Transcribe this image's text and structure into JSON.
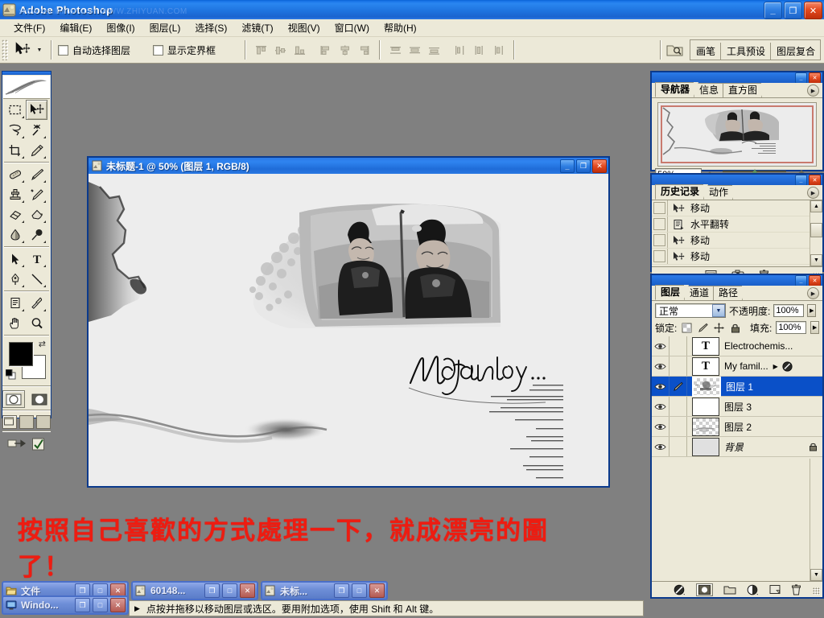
{
  "app": {
    "title": "Adobe Photoshop",
    "watermark": "www.souluntan.com  WWW.ZHIYUAN.COM",
    "icon": "photoshop-icon"
  },
  "window_buttons": {
    "minimize": "_",
    "restore": "❐",
    "close": "✕"
  },
  "menubar": {
    "items": [
      {
        "label": "文件(F)",
        "name": "menu-file"
      },
      {
        "label": "编辑(E)",
        "name": "menu-edit"
      },
      {
        "label": "图像(I)",
        "name": "menu-image"
      },
      {
        "label": "图层(L)",
        "name": "menu-layer"
      },
      {
        "label": "选择(S)",
        "name": "menu-select"
      },
      {
        "label": "滤镜(T)",
        "name": "menu-filter"
      },
      {
        "label": "视图(V)",
        "name": "menu-view"
      },
      {
        "label": "窗口(W)",
        "name": "menu-window"
      },
      {
        "label": "帮助(H)",
        "name": "menu-help"
      }
    ]
  },
  "options_bar": {
    "tool_icon": "move-tool-icon",
    "checkboxes": [
      {
        "label": "自动选择图层",
        "checked": false,
        "name": "auto-select-layer-checkbox"
      },
      {
        "label": "显示定界框",
        "checked": false,
        "name": "show-bounding-box-checkbox"
      }
    ],
    "align_group_1": [
      "align-top-edges-icon",
      "align-vertical-centers-icon",
      "align-bottom-edges-icon"
    ],
    "align_group_2": [
      "align-left-edges-icon",
      "align-horizontal-centers-icon",
      "align-right-edges-icon"
    ],
    "distribute_group_1": [
      "distribute-top-edges-icon",
      "distribute-vertical-centers-icon",
      "distribute-bottom-edges-icon"
    ],
    "distribute_group_2": [
      "distribute-left-edges-icon",
      "distribute-horizontal-centers-icon",
      "distribute-right-edges-icon"
    ],
    "file_browser_icon": "file-browser-icon",
    "palette_well": [
      {
        "label": "画笔",
        "name": "palette-well-brushes"
      },
      {
        "label": "工具预设",
        "name": "palette-well-tool-presets"
      },
      {
        "label": "图层复合",
        "name": "palette-well-layer-comps"
      }
    ]
  },
  "toolbox": {
    "tools": [
      {
        "name": "marquee-tool",
        "selected": false
      },
      {
        "name": "move-tool",
        "selected": true
      },
      {
        "name": "lasso-tool",
        "selected": false
      },
      {
        "name": "magic-wand-tool",
        "selected": false
      },
      {
        "name": "crop-tool",
        "selected": false
      },
      {
        "name": "slice-tool",
        "selected": false
      },
      {
        "name": "healing-brush-tool",
        "selected": false
      },
      {
        "name": "brush-tool",
        "selected": false
      },
      {
        "name": "clone-stamp-tool",
        "selected": false
      },
      {
        "name": "history-brush-tool",
        "selected": false
      },
      {
        "name": "eraser-tool",
        "selected": false
      },
      {
        "name": "gradient-tool",
        "selected": false
      },
      {
        "name": "blur-tool",
        "selected": false
      },
      {
        "name": "dodge-tool",
        "selected": false
      },
      {
        "name": "path-selection-tool",
        "selected": false
      },
      {
        "name": "type-tool",
        "selected": false
      },
      {
        "name": "pen-tool",
        "selected": false
      },
      {
        "name": "line-tool",
        "selected": false
      },
      {
        "name": "notes-tool",
        "selected": false
      },
      {
        "name": "eyedropper-tool",
        "selected": false
      },
      {
        "name": "hand-tool",
        "selected": false
      },
      {
        "name": "zoom-tool",
        "selected": false
      }
    ],
    "foreground_color": "#000000",
    "background_color": "#ffffff",
    "quick_mask": [
      "standard-mode",
      "quick-mask-mode"
    ],
    "screen_modes": [
      "standard-screen-mode",
      "full-screen-with-menubar",
      "full-screen-mode"
    ],
    "jump_to": [
      "jump-to-imageready-icon",
      "jump-to-edit-icon"
    ]
  },
  "document": {
    "title": "未标题-1 @ 50% (图层 1, RGB/8)",
    "icon": "document-icon",
    "zoom": "50%",
    "layer_name_in_title": "图层 1",
    "color_mode": "RGB/8",
    "script_text": "My family...",
    "buttons": {
      "minimize": "_",
      "maximize": "❐",
      "close": "✕"
    }
  },
  "annotation": {
    "text": "按照自己喜歡的方式處理一下，就成漂亮的圖了！",
    "color": "#ee1c11"
  },
  "navigator_palette": {
    "tabs": [
      {
        "label": "导航器",
        "active": true,
        "name": "tab-navigator"
      },
      {
        "label": "信息",
        "active": false,
        "name": "tab-info"
      },
      {
        "label": "直方图",
        "active": false,
        "name": "tab-histogram"
      }
    ],
    "zoom_value": "50%",
    "menu_icon": "palette-menu-icon"
  },
  "history_palette": {
    "tabs": [
      {
        "label": "历史记录",
        "active": true,
        "name": "tab-history"
      },
      {
        "label": "动作",
        "active": false,
        "name": "tab-actions"
      }
    ],
    "items": [
      {
        "label": "移动",
        "icon": "move-tool-icon"
      },
      {
        "label": "水平翻转",
        "icon": "flip-horizontal-icon"
      },
      {
        "label": "移动",
        "icon": "move-tool-icon"
      },
      {
        "label": "移动",
        "icon": "move-tool-icon"
      }
    ],
    "footer_icons": [
      "new-document-from-state-icon",
      "new-snapshot-icon",
      "delete-state-icon"
    ]
  },
  "layers_palette": {
    "tabs": [
      {
        "label": "图层",
        "active": true,
        "name": "tab-layers"
      },
      {
        "label": "通道",
        "active": false,
        "name": "tab-channels"
      },
      {
        "label": "路径",
        "active": false,
        "name": "tab-paths"
      }
    ],
    "blend_mode": "正常",
    "opacity_label": "不透明度:",
    "opacity_value": "100%",
    "lock_label": "锁定:",
    "lock_icons": [
      "lock-transparent-pixels-icon",
      "lock-image-pixels-icon",
      "lock-position-icon",
      "lock-all-icon"
    ],
    "fill_label": "填充:",
    "fill_value": "100%",
    "layers": [
      {
        "name": "Electrochemis...",
        "type": "text",
        "visible": true,
        "selected": false,
        "locked": false,
        "effects": false
      },
      {
        "name": "My famil...",
        "type": "text",
        "visible": true,
        "selected": false,
        "locked": false,
        "effects": true
      },
      {
        "name": "图层 1",
        "type": "pixel",
        "visible": true,
        "selected": true,
        "locked": false,
        "effects": false
      },
      {
        "name": "图层 3",
        "type": "pixel",
        "visible": true,
        "selected": false,
        "locked": false,
        "effects": false
      },
      {
        "name": "图层 2",
        "type": "pixel",
        "visible": true,
        "selected": false,
        "locked": false,
        "effects": false
      },
      {
        "name": "背景",
        "type": "background",
        "visible": true,
        "selected": false,
        "locked": true,
        "effects": false
      }
    ],
    "footer_icons": [
      "layer-style-icon",
      "layer-mask-icon",
      "new-group-icon",
      "new-adjustment-layer-icon",
      "new-layer-icon",
      "delete-layer-icon"
    ]
  },
  "statusbar": {
    "arrow": "▶",
    "text": "点按并拖移以移动图层或选区。要用附加选项，使用 Shift 和 Alt 键。"
  },
  "taskbar": {
    "windows": [
      {
        "label": "文件",
        "icon": "folder-icon",
        "name": "taskwin-files"
      },
      {
        "label": "Windo...",
        "icon": "monitor-icon",
        "name": "taskwin-windows"
      },
      {
        "label": "60148...",
        "icon": "image-icon",
        "name": "taskwin-60148"
      },
      {
        "label": "未标...",
        "icon": "image-icon",
        "name": "taskwin-untitled"
      }
    ],
    "buttons": {
      "restore": "❐",
      "maximize": "□",
      "close": "✕"
    }
  }
}
